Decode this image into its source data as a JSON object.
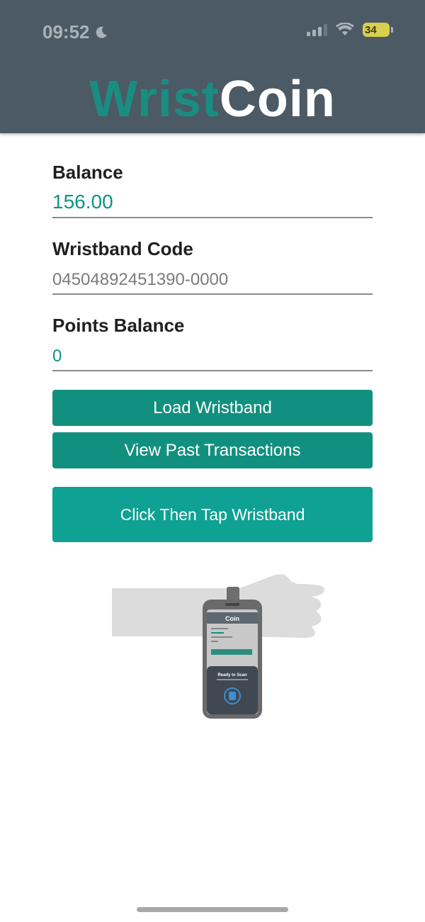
{
  "status_bar": {
    "time": "09:52",
    "battery": "34"
  },
  "app": {
    "logo_part1": "Wrist",
    "logo_part2": "Coin"
  },
  "fields": {
    "balance_label": "Balance",
    "balance_value": "156.00",
    "wristband_code_label": "Wristband Code",
    "wristband_code_value": "04504892451390-0000",
    "points_label": "Points Balance",
    "points_value": "0"
  },
  "buttons": {
    "load_wristband": "Load Wristband",
    "view_transactions": "View Past Transactions",
    "tap_wristband": "Click Then Tap Wristband"
  },
  "illustration": {
    "phone_logo": "Coin",
    "scan_title": "Ready to Scan",
    "scan_icon": "nfc-icon"
  },
  "colors": {
    "header": "#4b5a64",
    "accent": "#12907f",
    "value_text": "#0c9486"
  }
}
